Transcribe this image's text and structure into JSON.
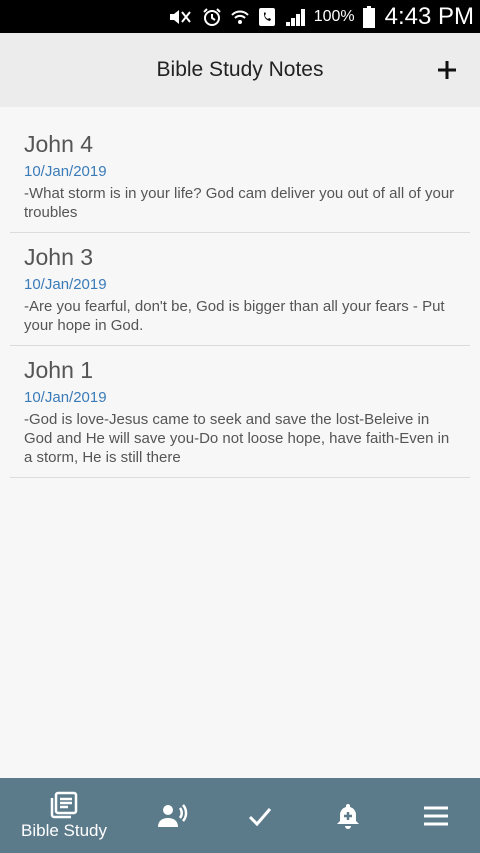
{
  "status_bar": {
    "battery_percent": "100%",
    "time": "4:43 PM"
  },
  "header": {
    "title": "Bible Study Notes",
    "add_icon": "plus-icon"
  },
  "notes": [
    {
      "heading": "John 4",
      "date": "10/Jan/2019",
      "text": "-What storm is in your life? God cam deliver you out of all of your troubles"
    },
    {
      "heading": "John 3",
      "date": "10/Jan/2019",
      "text": "-Are you fearful, don't be, God is bigger than all your fears - Put your hope in God."
    },
    {
      "heading": "John 1",
      "date": "10/Jan/2019",
      "text": "-God is love-Jesus came to seek and save the lost-Beleive in God and He will save you-Do not loose hope, have faith-Even in a storm, He is still there"
    }
  ],
  "bottom_nav": {
    "bible_study_label": "Bible Study",
    "items": [
      "book-icon",
      "speaker-icon",
      "check-icon",
      "bell-plus-icon",
      "menu-icon"
    ]
  },
  "colors": {
    "nav_background": "#5b7a8a",
    "date_text": "#3a7bb8",
    "header_background": "#ececec"
  }
}
